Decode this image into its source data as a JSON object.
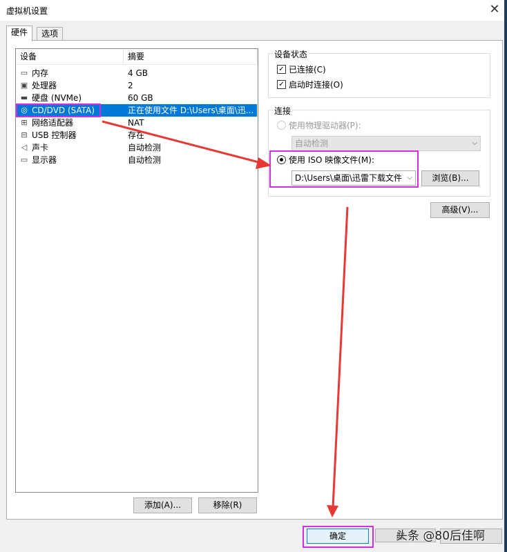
{
  "window": {
    "title": "虚拟机设置"
  },
  "tabs": [
    {
      "label": "硬件"
    },
    {
      "label": "选项"
    }
  ],
  "device_list": {
    "headers": {
      "device": "设备",
      "summary": "摘要"
    },
    "rows": [
      {
        "icon": "memory-icon",
        "name": "内存",
        "summary": "4 GB"
      },
      {
        "icon": "cpu-icon",
        "name": "处理器",
        "summary": "2"
      },
      {
        "icon": "hard-disk-icon",
        "name": "硬盘 (NVMe)",
        "summary": "60 GB"
      },
      {
        "icon": "cd-dvd-icon",
        "name": "CD/DVD (SATA)",
        "summary": "正在使用文件 D:\\Users\\桌面\\迅..."
      },
      {
        "icon": "network-icon",
        "name": "网络适配器",
        "summary": "NAT"
      },
      {
        "icon": "usb-icon",
        "name": "USB 控制器",
        "summary": "存在"
      },
      {
        "icon": "speaker-icon",
        "name": "声卡",
        "summary": "自动检测"
      },
      {
        "icon": "monitor-icon",
        "name": "显示器",
        "summary": "自动检测"
      }
    ]
  },
  "list_buttons": {
    "add": "添加(A)...",
    "remove": "移除(R)"
  },
  "device_status": {
    "title": "设备状态",
    "connected": {
      "label": "已连接(C)",
      "checked": true
    },
    "connect_at_power_on": {
      "label": "启动时连接(O)",
      "checked": true
    }
  },
  "connection": {
    "title": "连接",
    "physical_drive": {
      "label": "使用物理驱动器(P):",
      "selected": false,
      "dropdown_value": "自动检测"
    },
    "iso_image": {
      "label": "使用 ISO 映像文件(M):",
      "selected": true,
      "path_value": "D:\\Users\\桌面\\迅雷下载文件"
    },
    "browse_button": "浏览(B)..."
  },
  "advanced_button": "高级(V)...",
  "footer": {
    "ok": "确定",
    "cancel_partial": "取"
  },
  "watermark": "头条 @80后佳啊",
  "colors": {
    "selection": "#0078d7",
    "highlight_box": "#d02ee0",
    "annotation_arrow": "#e53935"
  }
}
